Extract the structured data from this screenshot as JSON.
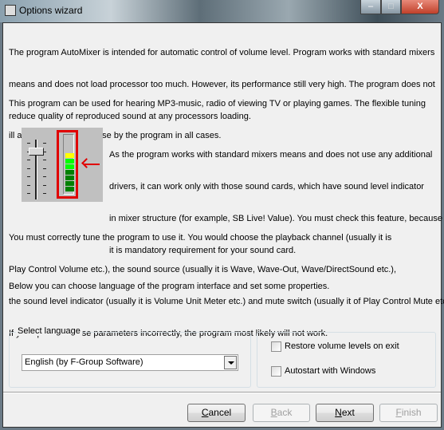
{
  "window": {
    "title": "Options wizard",
    "controls": {
      "minimize": "–",
      "maximize": "□",
      "close": "X"
    }
  },
  "paragraphs": {
    "intro": [
      "The program AutoMixer is intended for automatic control of volume level. Program works with standard mixers",
      "means and does not load processor too much. However, its performance still very high. The program does not",
      "reduce quality of reproduced sound at any processors loading."
    ],
    "usage": [
      "This program can be used for hearing MP3-music, radio of viewing TV or playing games. The flexible tuning",
      "ill allow you effectively use by the program in all cases."
    ],
    "mixer": [
      "As the program works with standard mixers means and does not use any additional",
      "drivers, it can work only with those sound cards, which have sound level indicator",
      "in mixer structure (for example, SB Live! Value). You must check this feature, because",
      "it is mandatory requirement for your sound card."
    ],
    "tuning": [
      "You must correctly tune the program to use it. You would choose the playback channel (usually it is",
      "Play Control Volume etc.), the sound source (usually it is Wave, Wave-Out, Wave/DirectSound etc.),",
      "the sound level indicator (usually it is Volume Unit Meter etc.) and mute switch (usually it of Play Control Mute etc.).",
      "If you specified these parameters incorrectly, the program most likely will not work."
    ],
    "below": [
      "Below you can choose language of the program interface and set some properties."
    ]
  },
  "language": {
    "legend": "Select language",
    "selected": "English (by F-Group Software)"
  },
  "options": {
    "restore": {
      "label": "Restore volume levels on exit",
      "checked": false
    },
    "autostart": {
      "label": "Autostart with Windows",
      "checked": false
    }
  },
  "buttons": {
    "cancel": {
      "accel": "C",
      "rest": "ancel",
      "enabled": true
    },
    "back": {
      "accel": "B",
      "rest": "ack",
      "enabled": false
    },
    "next": {
      "accel": "N",
      "rest": "ext",
      "enabled": true
    },
    "finish": {
      "accel": "F",
      "rest": "inish",
      "enabled": false
    }
  },
  "colors": {
    "highlight": "#e00000",
    "meter_yellow": "#ffff00",
    "meter_bright_green": "#00ff00",
    "meter_green": "#008000"
  }
}
